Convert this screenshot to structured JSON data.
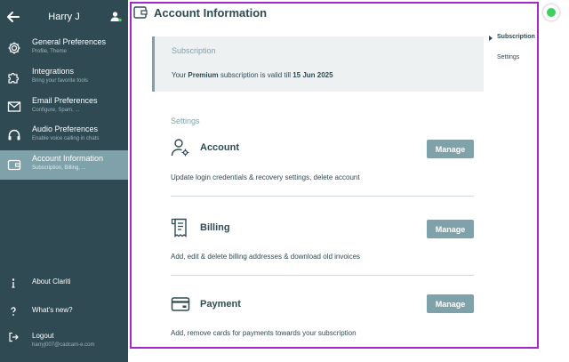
{
  "sidebar": {
    "user_name": "Harry J",
    "items": [
      {
        "label": "General Preferences",
        "sub": "Profile, Theme",
        "icon": "gear-icon"
      },
      {
        "label": "Integrations",
        "sub": "Bring your favorite tools",
        "icon": "puzzle-icon"
      },
      {
        "label": "Email Preferences",
        "sub": "Configure, Spam, ...",
        "icon": "mail-icon"
      },
      {
        "label": "Audio Preferences",
        "sub": "Enable voice calling in chats",
        "icon": "headset-icon"
      },
      {
        "label": "Account Information",
        "sub": "Subscription, Billing, ...",
        "icon": "wallet-icon",
        "active": true
      }
    ],
    "bottom": {
      "about": "About Clariti",
      "whats_new": "What's new?",
      "logout": "Logout",
      "email": "harryj007@cadcam-e.com"
    }
  },
  "main": {
    "title": "Account Information",
    "subscription": {
      "heading": "Subscription",
      "text_prefix": "Your ",
      "plan": "Premium",
      "text_middle": " subscription is valid till ",
      "date": "15 Jun 2025"
    },
    "settings_heading": "Settings",
    "sections": [
      {
        "title": "Account",
        "button": "Manage",
        "desc": "Update login credentials & recovery settings, delete account",
        "icon": "user-gear-icon"
      },
      {
        "title": "Billing",
        "button": "Manage",
        "desc": "Add, edit & delete billing addresses & download old invoices",
        "icon": "receipt-icon"
      },
      {
        "title": "Payment",
        "button": "Manage",
        "desc": "Add, remove cards for payments towards your subscription",
        "icon": "credit-card-icon"
      }
    ]
  },
  "toc": [
    {
      "label": "Subscription",
      "active": true
    },
    {
      "label": "Settings",
      "active": false
    }
  ],
  "colors": {
    "sidebar_bg": "#2f4a53",
    "accent": "#7ea1aa",
    "frame": "#a528c8",
    "status_online": "#3bd15a"
  }
}
